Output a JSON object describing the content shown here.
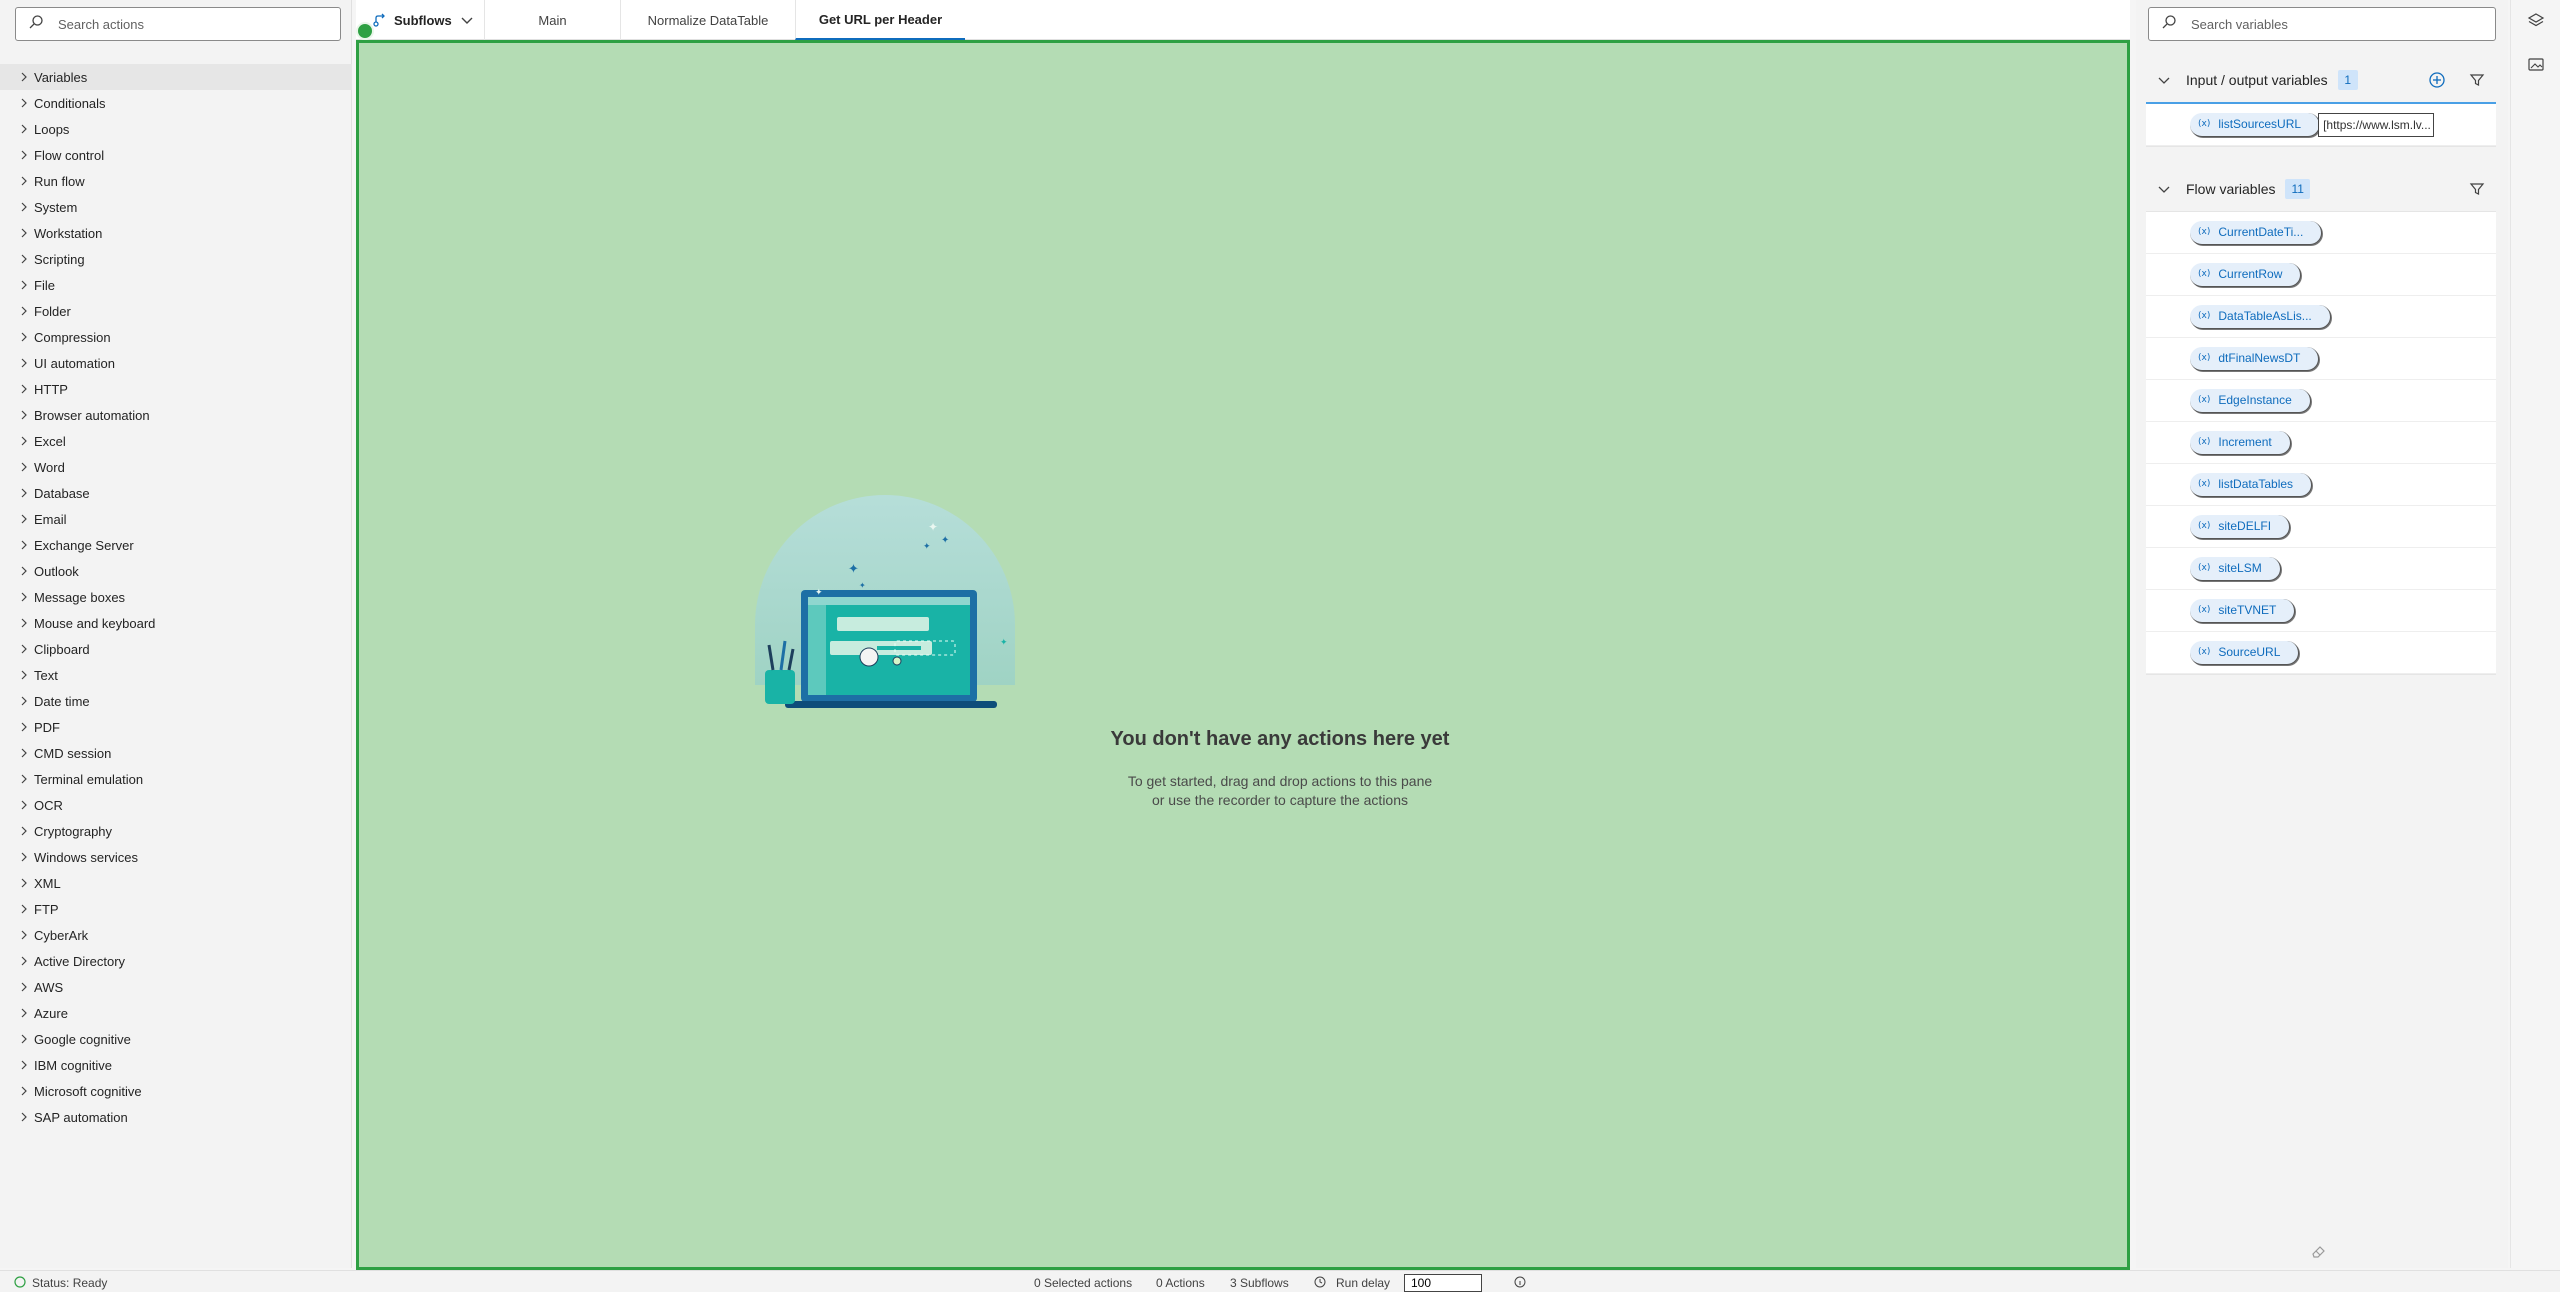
{
  "actions_pane": {
    "search_placeholder": "Search actions",
    "items": [
      {
        "label": "Variables"
      },
      {
        "label": "Conditionals"
      },
      {
        "label": "Loops"
      },
      {
        "label": "Flow control"
      },
      {
        "label": "Run flow"
      },
      {
        "label": "System"
      },
      {
        "label": "Workstation"
      },
      {
        "label": "Scripting"
      },
      {
        "label": "File"
      },
      {
        "label": "Folder"
      },
      {
        "label": "Compression"
      },
      {
        "label": "UI automation"
      },
      {
        "label": "HTTP"
      },
      {
        "label": "Browser automation"
      },
      {
        "label": "Excel"
      },
      {
        "label": "Word"
      },
      {
        "label": "Database"
      },
      {
        "label": "Email"
      },
      {
        "label": "Exchange Server"
      },
      {
        "label": "Outlook"
      },
      {
        "label": "Message boxes"
      },
      {
        "label": "Mouse and keyboard"
      },
      {
        "label": "Clipboard"
      },
      {
        "label": "Text"
      },
      {
        "label": "Date time"
      },
      {
        "label": "PDF"
      },
      {
        "label": "CMD session"
      },
      {
        "label": "Terminal emulation"
      },
      {
        "label": "OCR"
      },
      {
        "label": "Cryptography"
      },
      {
        "label": "Windows services"
      },
      {
        "label": "XML"
      },
      {
        "label": "FTP"
      },
      {
        "label": "CyberArk"
      },
      {
        "label": "Active Directory"
      },
      {
        "label": "AWS"
      },
      {
        "label": "Azure"
      },
      {
        "label": "Google cognitive"
      },
      {
        "label": "IBM cognitive"
      },
      {
        "label": "Microsoft cognitive"
      },
      {
        "label": "SAP automation"
      }
    ]
  },
  "tabs": {
    "subflows_label": "Subflows",
    "items": [
      {
        "label": "Main",
        "active": false
      },
      {
        "label": "Normalize DataTable",
        "active": false
      },
      {
        "label": "Get URL per Header",
        "active": true
      }
    ]
  },
  "canvas": {
    "empty_title": "You don't have any actions here yet",
    "empty_line1": "To get started, drag and drop actions to this pane",
    "empty_line2": "or use the recorder to capture the actions",
    "drop_color": "#b4dcb4",
    "drop_border": "#2ea043"
  },
  "variables_pane": {
    "search_placeholder": "Search variables",
    "io_section": {
      "title": "Input / output variables",
      "count": "1",
      "variables": [
        {
          "name": "listSourcesURL",
          "value": "[https://www.lsm.lv..."
        }
      ]
    },
    "flow_section": {
      "title": "Flow variables",
      "count": "11",
      "variables": [
        {
          "name": "CurrentDateTi..."
        },
        {
          "name": "CurrentRow"
        },
        {
          "name": "DataTableAsLis..."
        },
        {
          "name": "dtFinalNewsDT"
        },
        {
          "name": "EdgeInstance"
        },
        {
          "name": "Increment"
        },
        {
          "name": "listDataTables"
        },
        {
          "name": "siteDELFI"
        },
        {
          "name": "siteLSM"
        },
        {
          "name": "siteTVNET"
        },
        {
          "name": "SourceURL"
        }
      ]
    }
  },
  "status_bar": {
    "status": "Status: Ready",
    "selected": "0 Selected actions",
    "actions": "0 Actions",
    "subflows": "3 Subflows",
    "run_delay_label": "Run delay",
    "run_delay_value": "100"
  },
  "colors": {
    "accent": "#0f6cbd",
    "badge_bg": "#cfe4fa"
  },
  "icons": [
    "search-icon",
    "chevron-right-icon",
    "subflows-icon",
    "chevron-down-icon",
    "add-icon",
    "filter-icon",
    "variable-icon",
    "layers-icon",
    "image-icon",
    "eraser-icon",
    "info-icon",
    "status-icon"
  ]
}
